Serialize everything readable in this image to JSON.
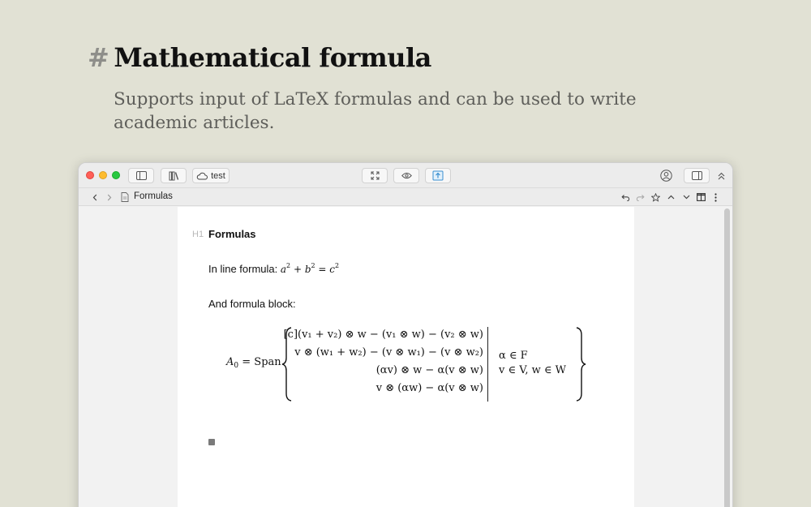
{
  "hero": {
    "hash": "#",
    "title": "Mathematical formula",
    "subtitle": "Supports input of LaTeX formulas and can be used to write academic articles."
  },
  "toolbar": {
    "cloud_label": "test"
  },
  "pathbar": {
    "document_name": "Formulas"
  },
  "editor": {
    "h1_marker": "H1",
    "heading": "Formulas",
    "inline_label": "In line formula:",
    "inline_formula": {
      "a": "a",
      "b": "b",
      "c": "c",
      "exp": "2",
      "plus": " + ",
      "eq": " = "
    },
    "block_label": "And formula block:"
  },
  "formula_block": {
    "lhs_base": "A",
    "lhs_sub": "0",
    "lhs_rest": " = Span",
    "rows": [
      "[c](v₁ + v₂) ⊗ w − (v₁ ⊗ w) − (v₂ ⊗ w)",
      "v ⊗ (w₁ + w₂) − (v ⊗ w₁) − (v ⊗ w₂)",
      "(αv) ⊗ w − α(v ⊗ w)",
      "v ⊗ (αw) − α(v ⊗ w)"
    ],
    "conditions": [
      "α ∈ F",
      "v ∈ V, w ∈ W"
    ]
  },
  "icons": [
    "sidebar-toggle-icon",
    "library-icon",
    "cloud-icon",
    "fullscreen-icon",
    "preview-eye-icon",
    "export-icon",
    "account-icon",
    "right-panel-icon",
    "collapse-up-icon",
    "back-chevron-icon",
    "forward-chevron-icon",
    "document-icon",
    "undo-icon",
    "redo-icon",
    "star-icon",
    "chevron-up-icon",
    "chevron-down-icon",
    "split-view-icon",
    "more-icon"
  ]
}
